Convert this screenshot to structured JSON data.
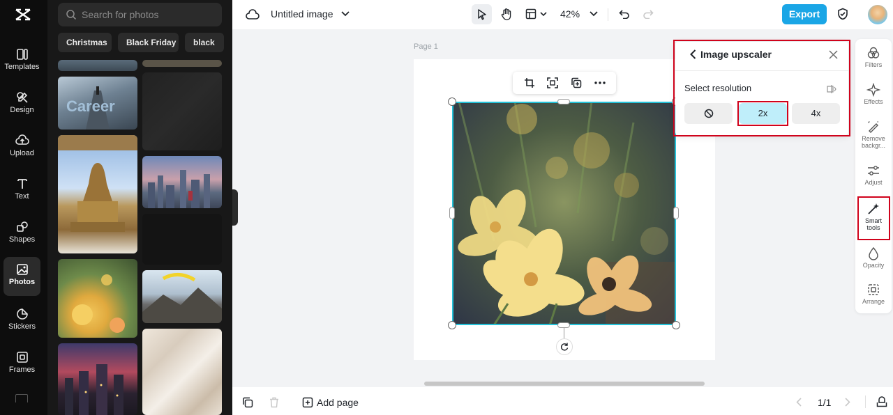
{
  "nav": {
    "logo_label": "CapCut logo",
    "items": [
      {
        "label": "Templates",
        "icon": "templates-icon"
      },
      {
        "label": "Design",
        "icon": "design-icon"
      },
      {
        "label": "Upload",
        "icon": "upload-icon"
      },
      {
        "label": "Text",
        "icon": "text-icon"
      },
      {
        "label": "Shapes",
        "icon": "shapes-icon"
      },
      {
        "label": "Photos",
        "icon": "photos-icon",
        "active": true
      },
      {
        "label": "Stickers",
        "icon": "stickers-icon"
      },
      {
        "label": "Frames",
        "icon": "frames-icon"
      }
    ]
  },
  "photos_panel": {
    "search_placeholder": "Search for photos",
    "chips": [
      "Christmas",
      "Black Friday",
      "black"
    ]
  },
  "topbar": {
    "title": "Untitled image",
    "zoom": "42%",
    "export_label": "Export"
  },
  "canvas": {
    "page_label": "Page 1"
  },
  "upscaler": {
    "title": "Image upscaler",
    "subtitle": "Select resolution",
    "options": [
      "none",
      "2x",
      "4x"
    ],
    "selected": "2x"
  },
  "right_tools": [
    {
      "label": "Filters",
      "icon": "filters-icon"
    },
    {
      "label": "Effects",
      "icon": "effects-icon"
    },
    {
      "label": "Remove backgr...",
      "icon": "remove-background-icon"
    },
    {
      "label": "Adjust",
      "icon": "adjust-icon"
    },
    {
      "label": "Smart tools",
      "icon": "smart-tools-icon"
    },
    {
      "label": "Opacity",
      "icon": "opacity-icon"
    },
    {
      "label": "Arrange",
      "icon": "arrange-icon"
    }
  ],
  "bottombar": {
    "add_page_label": "Add page",
    "page_counter": "1/1"
  },
  "colors": {
    "accent": "#1aa6e6",
    "selection": "#25c2d9",
    "highlight": "#d0021b",
    "selected_option": "#bfeefa"
  }
}
